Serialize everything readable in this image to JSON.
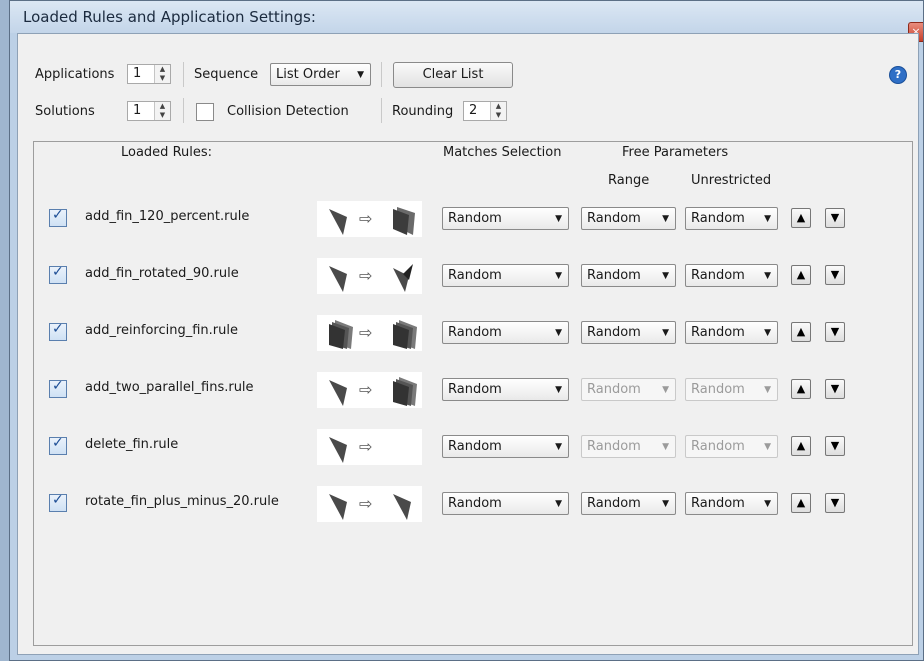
{
  "window": {
    "title": "Loaded Rules and Application Settings:",
    "close_glyph": "×"
  },
  "toolbar": {
    "applications_label": "Applications",
    "applications_value": "1",
    "sequence_label": "Sequence",
    "sequence_value": "List Order",
    "clear_list_label": "Clear List",
    "solutions_label": "Solutions",
    "solutions_value": "1",
    "collision_label": "Collision Detection",
    "collision_checked": false,
    "rounding_label": "Rounding",
    "rounding_value": "2",
    "help_glyph": "?"
  },
  "headers": {
    "loaded_rules": "Loaded Rules:",
    "matches_selection": "Matches Selection",
    "free_parameters": "Free Parameters",
    "range": "Range",
    "unrestricted": "Unrestricted"
  },
  "rules": [
    {
      "name": "add_fin_120_percent.rule",
      "checked": true,
      "matches": "Random",
      "range": "Random",
      "unrestricted": "Random",
      "range_enabled": true,
      "unrestricted_enabled": true
    },
    {
      "name": "add_fin_rotated_90.rule",
      "checked": true,
      "matches": "Random",
      "range": "Random",
      "unrestricted": "Random",
      "range_enabled": true,
      "unrestricted_enabled": true
    },
    {
      "name": "add_reinforcing_fin.rule",
      "checked": true,
      "matches": "Random",
      "range": "Random",
      "unrestricted": "Random",
      "range_enabled": true,
      "unrestricted_enabled": true
    },
    {
      "name": "add_two_parallel_fins.rule",
      "checked": true,
      "matches": "Random",
      "range": "Random",
      "unrestricted": "Random",
      "range_enabled": false,
      "unrestricted_enabled": false
    },
    {
      "name": "delete_fin.rule",
      "checked": true,
      "matches": "Random",
      "range": "Random",
      "unrestricted": "Random",
      "range_enabled": false,
      "unrestricted_enabled": false
    },
    {
      "name": "rotate_fin_plus_minus_20.rule",
      "checked": true,
      "matches": "Random",
      "range": "Random",
      "unrestricted": "Random",
      "range_enabled": true,
      "unrestricted_enabled": true
    }
  ],
  "icons": {
    "arrow": "⇨",
    "up": "▲",
    "down": "▼",
    "dropdown": "▼",
    "check": "✓"
  }
}
